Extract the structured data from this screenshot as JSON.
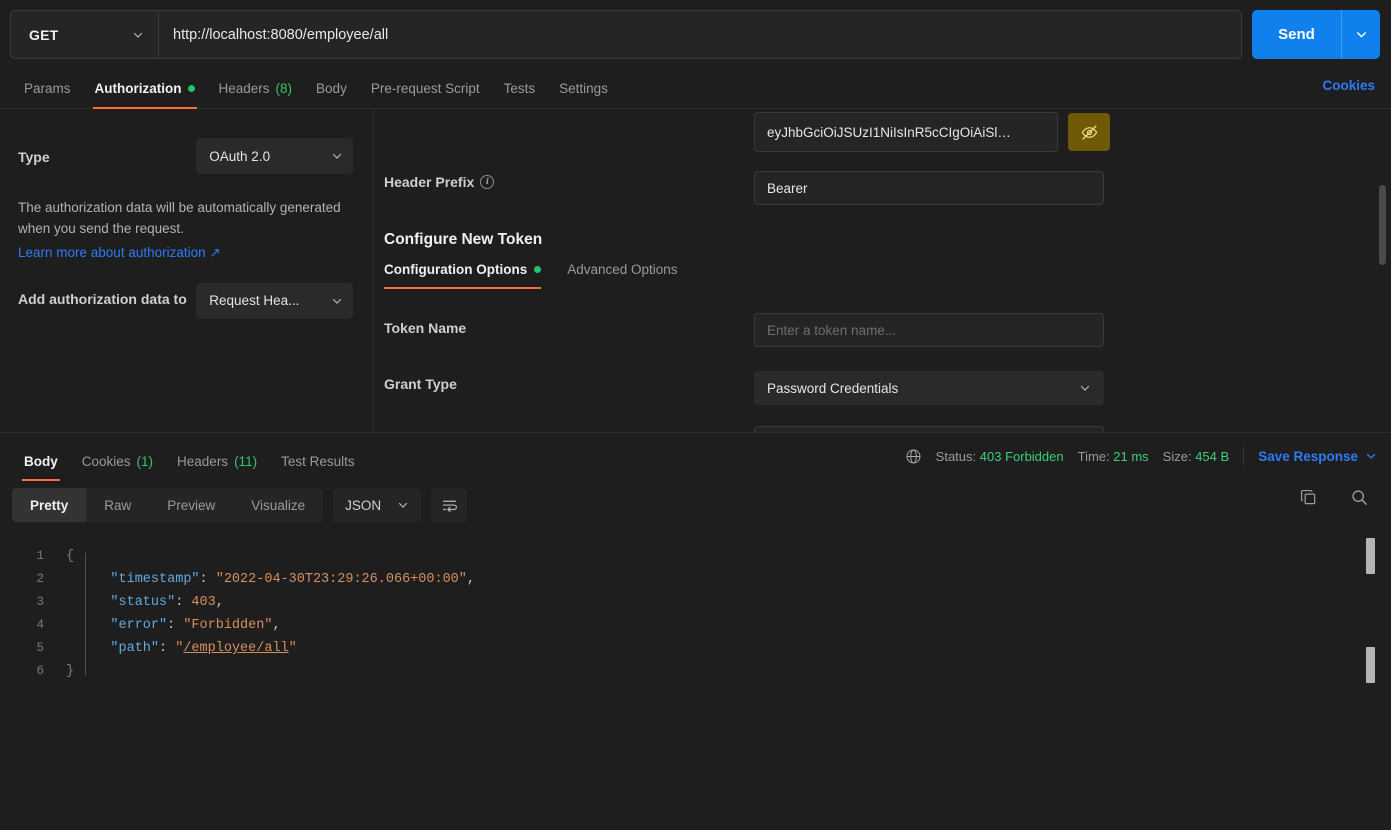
{
  "request": {
    "method": "GET",
    "url": "http://localhost:8080/employee/all",
    "send_label": "Send",
    "tabs": [
      {
        "label": "Params",
        "active": false,
        "count": "",
        "dot": false
      },
      {
        "label": "Authorization",
        "active": true,
        "count": "",
        "dot": true
      },
      {
        "label": "Headers",
        "active": false,
        "count": "(8)",
        "dot": false
      },
      {
        "label": "Body",
        "active": false,
        "count": "",
        "dot": false
      },
      {
        "label": "Pre-request Script",
        "active": false,
        "count": "",
        "dot": false
      },
      {
        "label": "Tests",
        "active": false,
        "count": "",
        "dot": false
      },
      {
        "label": "Settings",
        "active": false,
        "count": "",
        "dot": false
      }
    ],
    "cookies_link": "Cookies"
  },
  "auth": {
    "type_label": "Type",
    "type_value": "OAuth 2.0",
    "help_text": "The authorization data will be automatically generated when you send the request.",
    "learn_more": "Learn more about authorization ↗",
    "add_to_label": "Add authorization data to",
    "add_to_value": "Request Hea...",
    "access_token_value": "eyJhbGciOiJSUzI1NiIsInR5cCIgOiAiSl…",
    "eye_icon": "eye-off-icon",
    "header_prefix_label": "Header Prefix",
    "header_prefix_value": "Bearer",
    "configure_title": "Configure New Token",
    "subtabs": [
      {
        "label": "Configuration Options",
        "active": true,
        "dot": true
      },
      {
        "label": "Advanced Options",
        "active": false,
        "dot": false
      }
    ],
    "token_name_label": "Token Name",
    "token_name_placeholder": "Enter a token name...",
    "grant_type_label": "Grant Type",
    "grant_type_value": "Password Credentials"
  },
  "response": {
    "tabs": [
      {
        "label": "Body",
        "count": "",
        "active": true
      },
      {
        "label": "Cookies",
        "count": "(1)",
        "active": false
      },
      {
        "label": "Headers",
        "count": "(11)",
        "active": false
      },
      {
        "label": "Test Results",
        "count": "",
        "active": false
      }
    ],
    "status_label": "Status:",
    "status_value": "403 Forbidden",
    "time_label": "Time:",
    "time_value": "21 ms",
    "size_label": "Size:",
    "size_value": "454 B",
    "save_response": "Save Response",
    "globe_icon": "globe-icon",
    "views": [
      {
        "label": "Pretty",
        "active": true
      },
      {
        "label": "Raw",
        "active": false
      },
      {
        "label": "Preview",
        "active": false
      },
      {
        "label": "Visualize",
        "active": false
      }
    ],
    "format": "JSON",
    "wrap_icon": "word-wrap-icon",
    "copy_icon": "copy-icon",
    "search_icon": "search-icon",
    "body_lines": [
      {
        "no": "1",
        "fold": "{",
        "segments": []
      },
      {
        "no": "2",
        "fold": "",
        "segments": [
          {
            "t": "    ",
            "c": "p"
          },
          {
            "t": "\"timestamp\"",
            "c": "k"
          },
          {
            "t": ": ",
            "c": "p"
          },
          {
            "t": "\"2022-04-30T23:29:26.066+00:00\"",
            "c": "s"
          },
          {
            "t": ",",
            "c": "p"
          }
        ]
      },
      {
        "no": "3",
        "fold": "",
        "segments": [
          {
            "t": "    ",
            "c": "p"
          },
          {
            "t": "\"status\"",
            "c": "k"
          },
          {
            "t": ": ",
            "c": "p"
          },
          {
            "t": "403",
            "c": "n"
          },
          {
            "t": ",",
            "c": "p"
          }
        ]
      },
      {
        "no": "4",
        "fold": "",
        "segments": [
          {
            "t": "    ",
            "c": "p"
          },
          {
            "t": "\"error\"",
            "c": "k"
          },
          {
            "t": ": ",
            "c": "p"
          },
          {
            "t": "\"Forbidden\"",
            "c": "s"
          },
          {
            "t": ",",
            "c": "p"
          }
        ]
      },
      {
        "no": "5",
        "fold": "",
        "segments": [
          {
            "t": "    ",
            "c": "p"
          },
          {
            "t": "\"path\"",
            "c": "k"
          },
          {
            "t": ": ",
            "c": "p"
          },
          {
            "t": "\"",
            "c": "s"
          },
          {
            "t": "/employee/all",
            "c": "s link"
          },
          {
            "t": "\"",
            "c": "s"
          }
        ]
      },
      {
        "no": "6",
        "fold": "}",
        "segments": []
      }
    ]
  },
  "colors": {
    "accent_orange": "#ff6c37",
    "blue": "#2e7bf6",
    "send_blue": "#1080ec",
    "green": "#3ad07a",
    "token_btn": "#6e5a06"
  }
}
